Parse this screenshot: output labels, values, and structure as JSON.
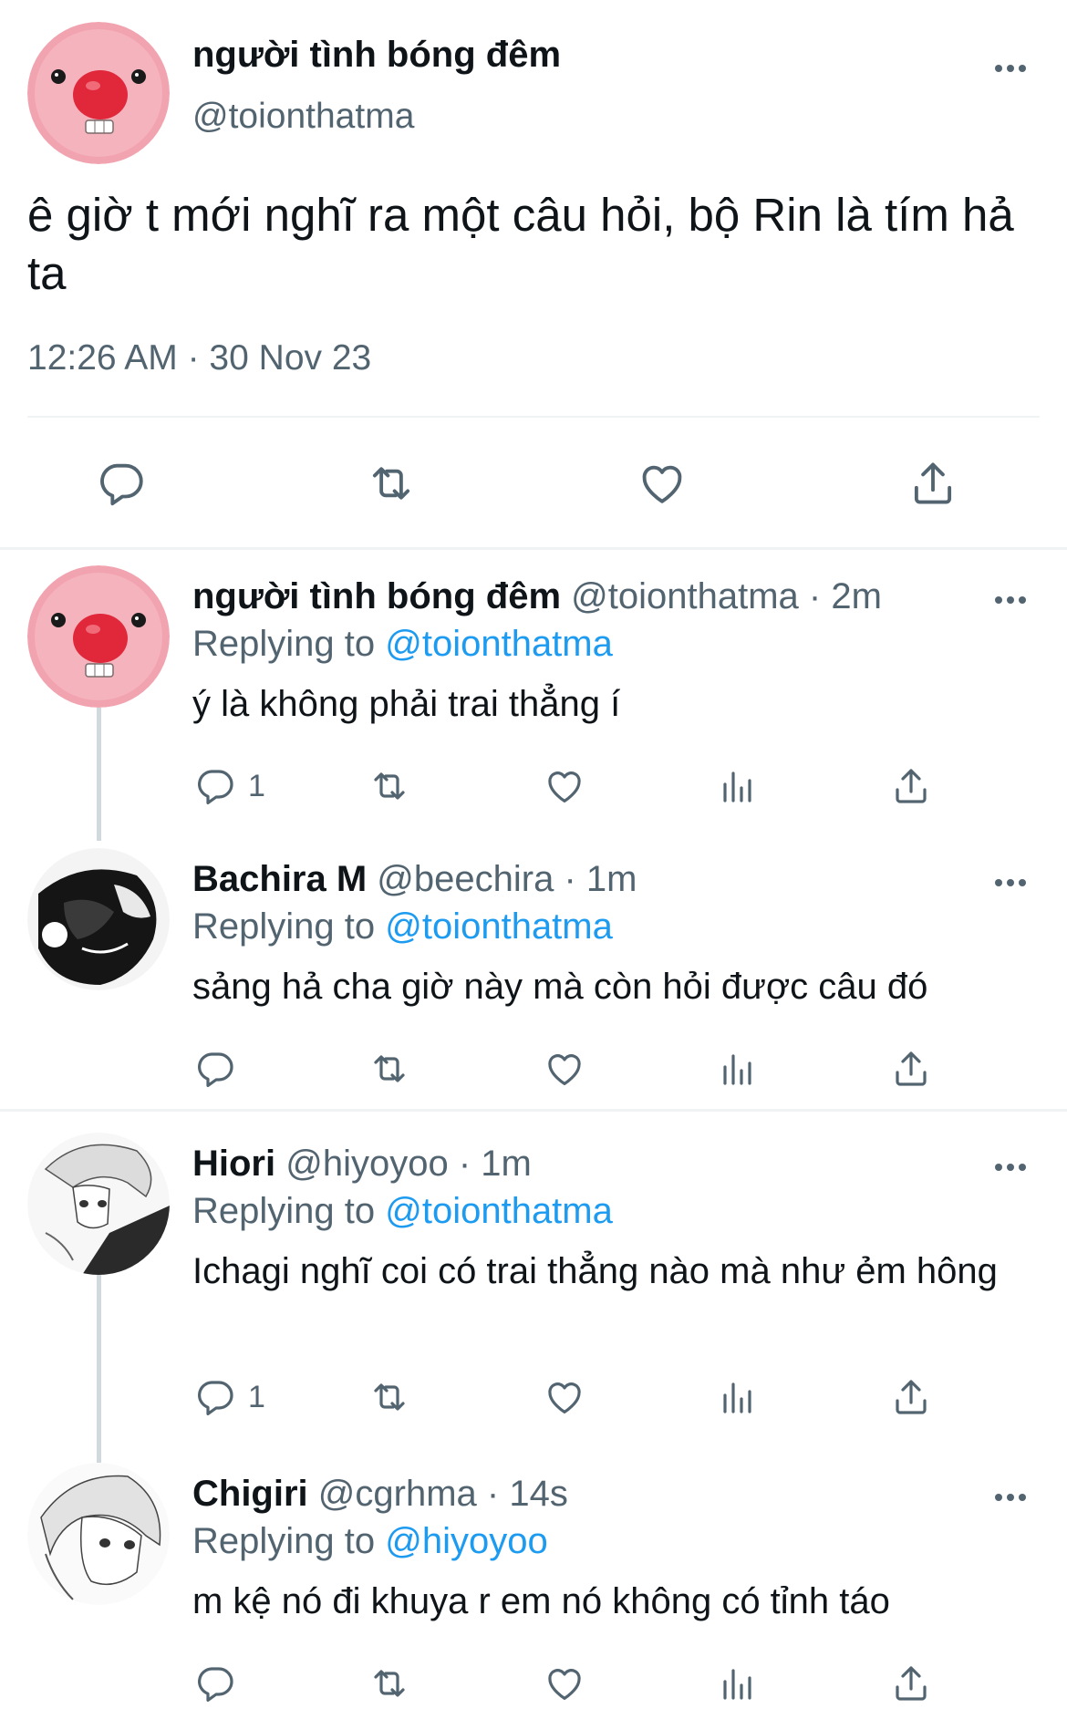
{
  "main_tweet": {
    "author_name": "người tình bóng đêm",
    "author_handle": "@toionthatma",
    "text": "ê giờ t mới nghĩ ra một câu hỏi, bộ Rin là tím hả ta",
    "timestamp": "12:26 AM · 30 Nov 23",
    "icons": [
      "reply-icon",
      "retweet-icon",
      "like-icon",
      "share-icon"
    ]
  },
  "replies": [
    {
      "author_name": "người tình bóng đêm",
      "meta": "@toionthatma · 2m",
      "replying_prefix": "Replying to ",
      "replying_to": "@toionthatma",
      "text": "ý là không phải trai thẳng í",
      "reply_count": "1"
    },
    {
      "author_name": "Bachira M",
      "meta": "@beechira · 1m",
      "replying_prefix": "Replying to ",
      "replying_to": "@toionthatma",
      "text": "sảng hả cha giờ này mà còn hỏi được câu đó",
      "reply_count": ""
    },
    {
      "author_name": "Hiori",
      "meta": "@hiyoyoo · 1m",
      "replying_prefix": "Replying to ",
      "replying_to": "@toionthatma",
      "text": "Ichagi nghĩ coi có trai thẳng nào mà như ẻm hông",
      "reply_count": "1"
    },
    {
      "author_name": "Chigiri",
      "meta": "@cgrhma · 14s",
      "replying_prefix": "Replying to ",
      "replying_to": "@hiyoyoo",
      "text": "m kệ nó đi khuya r em nó không có tỉnh táo",
      "reply_count": ""
    }
  ],
  "colors": {
    "text": "#0f1419",
    "secondary": "#536471",
    "link": "#1d9bf0",
    "divider": "#eff3f4",
    "thread_line": "#cfd9de",
    "avatar_pink": "#f2a3b0",
    "avatar_nose": "#e0283a"
  }
}
